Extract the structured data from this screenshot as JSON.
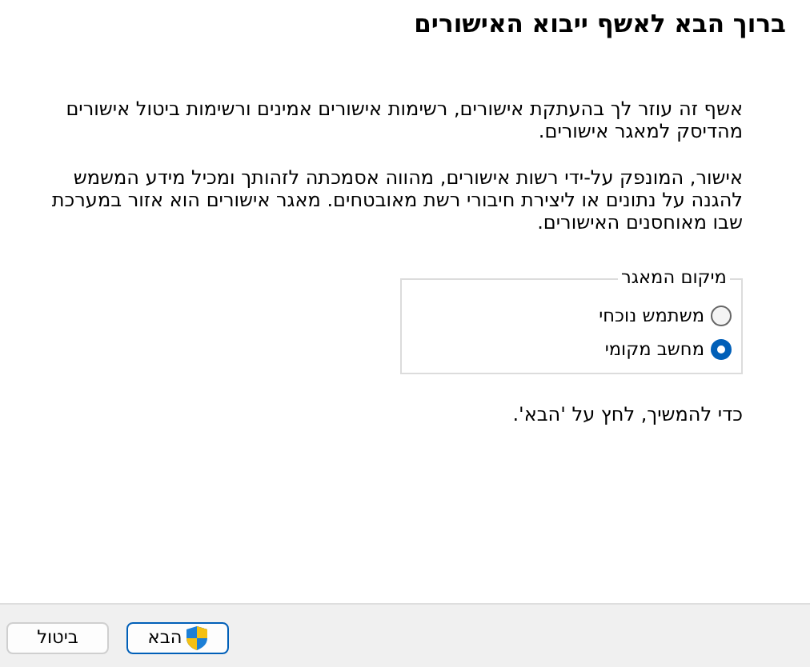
{
  "title": "ברוך הבא לאשף ייבוא האישורים",
  "paragraphs": [
    "אשף זה עוזר לך בהעתקת אישורים, רשימות אישורים אמינים ורשימות ביטול אישורים מהדיסק למאגר אישורים.",
    "אישור, המונפק על-ידי רשות אישורים, מהווה אסמכתה לזהותך ומכיל מידע המשמש להגנה על נתונים או ליצירת חיבורי רשת מאובטחים. מאגר אישורים הוא אזור במערכת שבו מאוחסנים האישורים."
  ],
  "store_location": {
    "legend": "מיקום המאגר",
    "options": [
      {
        "label": "משתמש נוכחי",
        "selected": false
      },
      {
        "label": "מחשב מקומי",
        "selected": true
      }
    ]
  },
  "hint": "כדי להמשיך, לחץ על 'הבא'.",
  "buttons": [
    {
      "label": "הבא",
      "kind": "shield",
      "default": true
    },
    {
      "label": "ביטול",
      "kind": "plain",
      "default": false
    }
  ]
}
